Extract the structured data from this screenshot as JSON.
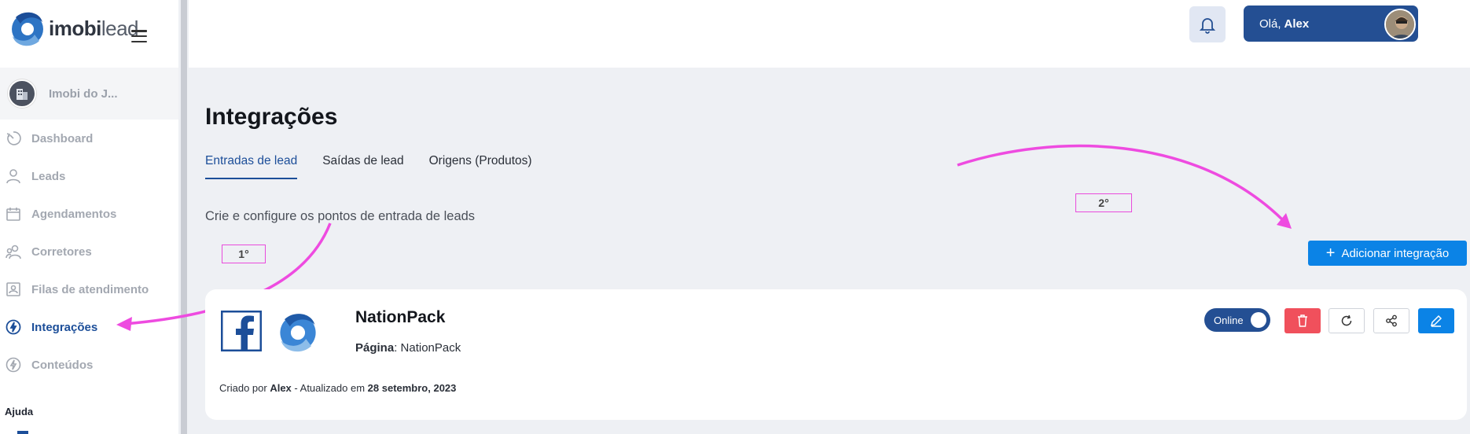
{
  "logo": {
    "brand_bold": "imobi",
    "brand_light": "lead"
  },
  "company": {
    "name": "Imobi do J..."
  },
  "sidebar": {
    "items": [
      {
        "label": "Dashboard",
        "icon": "dashboard-icon"
      },
      {
        "label": "Leads",
        "icon": "user-icon"
      },
      {
        "label": "Agendamentos",
        "icon": "calendar-icon"
      },
      {
        "label": "Corretores",
        "icon": "users-icon"
      },
      {
        "label": "Filas de atendimento",
        "icon": "queue-icon"
      },
      {
        "label": "Integrações",
        "icon": "lightning-icon",
        "active": true
      },
      {
        "label": "Conteúdos",
        "icon": "lightning-icon"
      }
    ],
    "help_title": "Ajuda"
  },
  "header": {
    "greeting": "Olá,",
    "user_name": "Alex"
  },
  "page": {
    "title": "Integrações",
    "tabs": [
      "Entradas de lead",
      "Saídas de lead",
      "Origens (Produtos)"
    ],
    "active_tab": "Entradas de lead",
    "subtitle": "Crie e configure os pontos de entrada de leads",
    "add_button": "Adicionar integração"
  },
  "annotations": {
    "first": "1°",
    "second": "2°"
  },
  "integration": {
    "name": "NationPack",
    "page_label": "Página",
    "page_value": "NationPack",
    "status": "Online",
    "created_by_prefix": "Criado por",
    "created_by": "Alex",
    "updated_prefix": "- Atualizado em",
    "updated_at": "28 setembro, 2023"
  },
  "colors": {
    "primary": "#244f93",
    "accent": "#0b83e6",
    "danger": "#f0505c",
    "annotation": "#e94bdc",
    "active_nav": "#1c4e99"
  }
}
